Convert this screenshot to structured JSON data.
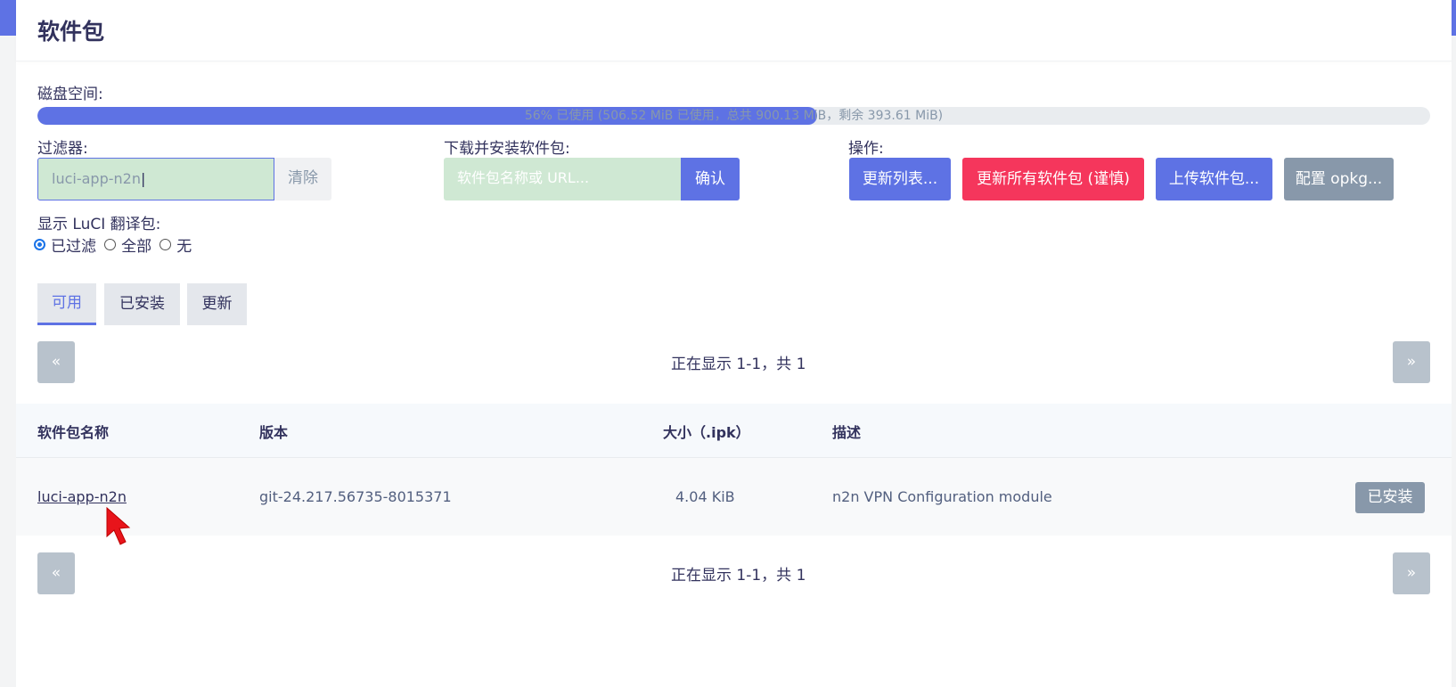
{
  "page": {
    "title": "软件包"
  },
  "disk": {
    "label": "磁盘空间:",
    "used_fraction": 0.56,
    "text": "56% 已使用 (506.52 MiB 已使用，总共 900.13 MiB，剩余 393.61 MiB)"
  },
  "filter": {
    "label": "过滤器:",
    "value": "luci-app-n2n",
    "clear_label": "清除"
  },
  "download": {
    "label": "下载并安装软件包:",
    "placeholder": "软件包名称或 URL...",
    "confirm_label": "确认"
  },
  "actions": {
    "label": "操作:",
    "update_lists": "更新列表...",
    "upgrade_all": "更新所有软件包 (谨慎)",
    "upload": "上传软件包...",
    "configure": "配置 opkg..."
  },
  "luci_translations": {
    "label": "显示 LuCI 翻译包:",
    "options": [
      "已过滤",
      "全部",
      "无"
    ],
    "selected": "已过滤"
  },
  "tabs": [
    "可用",
    "已安装",
    "更新"
  ],
  "active_tab": "可用",
  "pager": {
    "prev": "«",
    "next": "»",
    "status": "正在显示 1-1，共 1"
  },
  "table": {
    "headers": [
      "软件包名称",
      "版本",
      "大小（.ipk）",
      "描述"
    ],
    "rows": [
      {
        "name": "luci-app-n2n",
        "version": "git-24.217.56735-8015371",
        "size": "4.04 KiB",
        "description": "n2n VPN Configuration module",
        "action": "已安装"
      }
    ]
  },
  "colors": {
    "accent": "#5e72e4",
    "danger": "#f5365c",
    "muted": "#8898aa",
    "input_bg": "#cfe8d3"
  }
}
